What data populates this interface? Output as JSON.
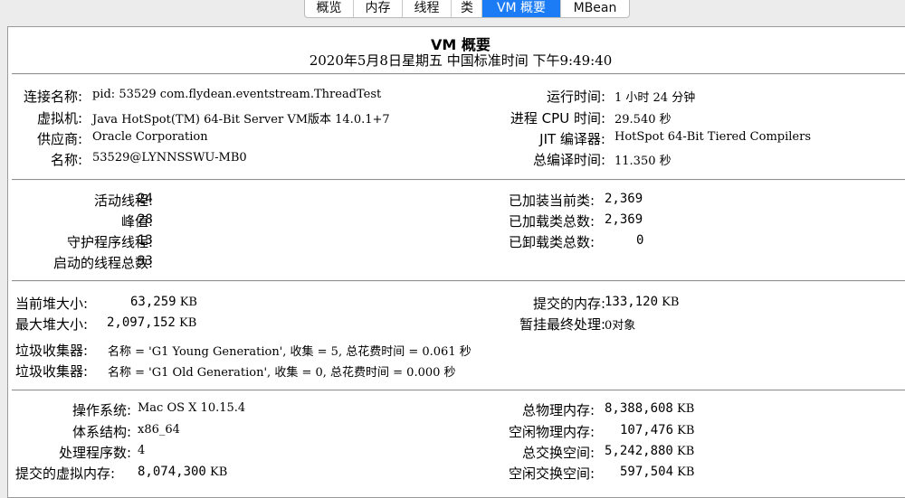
{
  "tabs": [
    {
      "label": "概览",
      "selected": false
    },
    {
      "label": "内存",
      "selected": false
    },
    {
      "label": "线程",
      "selected": false
    },
    {
      "label": "类",
      "selected": false
    },
    {
      "label": "VM 概要",
      "selected": true
    },
    {
      "label": "MBean",
      "selected": false
    }
  ],
  "header": {
    "title": "VM 概要",
    "datetime": "2020年5月8日星期五 中国标准时间 下午9:49:40"
  },
  "connection": {
    "name_label": "连接名称:",
    "name_value": "pid: 53529 com.flydean.eventstream.ThreadTest",
    "vm_label": "虚拟机:",
    "vm_value": "Java HotSpot(TM) 64-Bit Server VM版本 14.0.1+7",
    "vendor_label": "供应商:",
    "vendor_value": "Oracle Corporation",
    "nm_label": "名称:",
    "nm_value": "53529@LYNNSSWU-MB0",
    "uptime_label": "运行时间:",
    "uptime_value": "1 小时 24 分钟",
    "cputime_label": "进程 CPU 时间:",
    "cputime_value": "29.540 秒",
    "jit_label": "JIT 编译器:",
    "jit_value": "HotSpot 64-Bit Tiered Compilers",
    "compile_label": "总编译时间:",
    "compile_value": "11.350 秒"
  },
  "threads": {
    "live_label": "活动线程:",
    "live_value": "24",
    "peak_label": "峰值:",
    "peak_value": "28",
    "daemon_label": "守护程序线程:",
    "daemon_value": "13",
    "started_label": "启动的线程总数:",
    "started_value": "33",
    "loaded_label": "已加装当前类:",
    "loaded_value": "2,369",
    "total_loaded_label": "已加载类总数:",
    "total_loaded_value": "2,369",
    "unloaded_label": "已卸载类总数:",
    "unloaded_value": "0"
  },
  "memory": {
    "heap_label": "当前堆大小:",
    "heap_value": "63,259",
    "heap_unit": "KB",
    "maxheap_label": "最大堆大小:",
    "maxheap_value": "2,097,152",
    "maxheap_unit": "KB",
    "committed_label": "提交的内存:",
    "committed_value": "133,120",
    "committed_unit": "KB",
    "pending_label": "暂挂最终处理:",
    "pending_value": "0对象",
    "gc1_label": "垃圾收集器:",
    "gc1_value": "名称 = 'G1 Young Generation', 收集 = 5, 总花费时间 = 0.061 秒",
    "gc2_label": "垃圾收集器:",
    "gc2_value": "名称 = 'G1 Old Generation', 收集 = 0, 总花费时间 = 0.000 秒"
  },
  "system": {
    "os_label": "操作系统:",
    "os_value": "Mac OS X 10.15.4",
    "arch_label": "体系结构:",
    "arch_value": "x86_64",
    "cpus_label": "处理程序数:",
    "cpus_value": "4",
    "vmem_label": "提交的虚拟内存:",
    "vmem_value": "8,074,300",
    "vmem_unit": "KB",
    "phys_label": "总物理内存:",
    "phys_value": "8,388,608",
    "phys_unit": "KB",
    "freephys_label": "空闲物理内存:",
    "freephys_value": "107,476",
    "freephys_unit": "KB",
    "swap_label": "总交换空间:",
    "swap_value": "5,242,880",
    "swap_unit": "KB",
    "freeswap_label": "空闲交换空间:",
    "freeswap_value": "597,504",
    "freeswap_unit": "KB"
  }
}
